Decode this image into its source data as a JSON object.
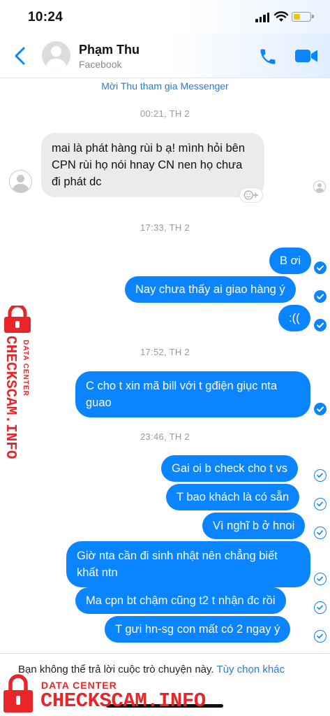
{
  "status_bar": {
    "time": "10:24"
  },
  "header": {
    "name": "Phạm Thu",
    "subtitle": "Facebook"
  },
  "invite_text": "Mời Thu tham gia Messenger",
  "timestamps": [
    "00:21, TH 2",
    "17:33, TH 2",
    "17:52, TH 2",
    "23:46, TH 2"
  ],
  "messages": {
    "incoming_1": "mai là phát hàng rùi b ạ! mình hỏi bên CPN rùi họ nói hnay CN nen họ chưa đi phát dc",
    "out_1": "B ơi",
    "out_2": "Nay chưa thấy ai giao hàng ý",
    "out_3": ":((",
    "out_4": "C cho t xin mã bill với t gđiện giục nta guao",
    "out_5": "Gai oi b check cho t vs",
    "out_6": "T bao khách là có sẵn",
    "out_7": "Vì nghĩ b ở hnoi",
    "out_8": "Giờ nta cần đi sinh nhật nên chẳng biết khất ntn",
    "out_9": "Ma cpn bt chậm cũng t2 t nhận đc rồi",
    "out_10": "T gưi hn-sg con mất có 2 ngay ý"
  },
  "footer": {
    "text": "Bạn không thể trả lời cuộc trò chuyện này.",
    "link": "Tùy chọn khác"
  },
  "watermark": {
    "small": "DATA CENTER",
    "big": "CHECKSCAM.INFO"
  },
  "colors": {
    "accent": "#0a84ff",
    "watermark": "#e8262a"
  },
  "icons": [
    "back-chevron-icon",
    "phone-icon",
    "video-camera-icon",
    "add-reaction-icon",
    "sent-check-icon",
    "delivered-check-icon",
    "lock-icon"
  ]
}
